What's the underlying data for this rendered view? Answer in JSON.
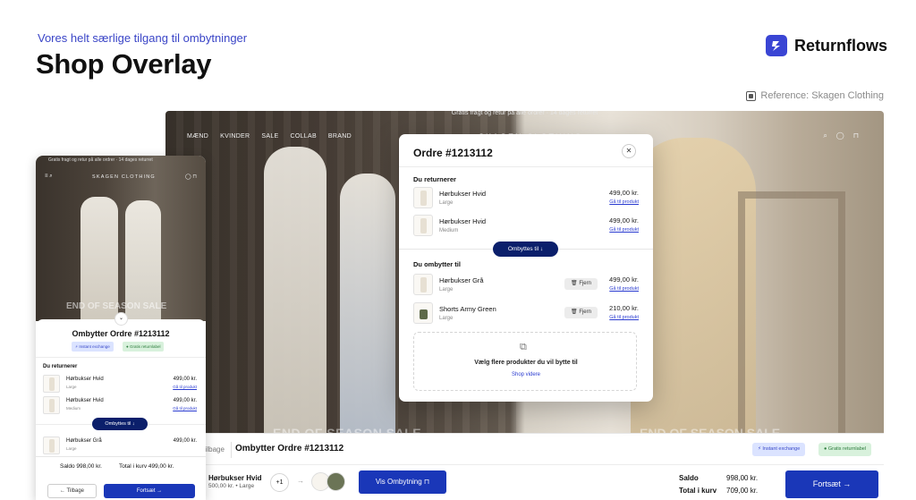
{
  "header": {
    "subtitle": "Vores helt særlige tilgang til ombytninger",
    "title": "Shop Overlay",
    "brand": "Returnflows",
    "reference": "Reference: Skagen Clothing"
  },
  "store": {
    "promo": "Gratis fragt og retur på alle ordrer · 14 dages returret",
    "nav": [
      "MÆND",
      "KVINDER",
      "SALE",
      "COLLAB",
      "BRAND"
    ],
    "logo": "SKAGEN CLOTHING",
    "hero_text": "END OF SEASON SALE"
  },
  "modal": {
    "title": "Ordre #1213112",
    "returning_label": "Du returnerer",
    "returning": [
      {
        "name": "Hørbukser Hvid",
        "size": "Large",
        "price": "499,00 kr.",
        "link": "Gå til produkt"
      },
      {
        "name": "Hørbukser Hvid",
        "size": "Medium",
        "price": "499,00 kr.",
        "link": "Gå til produkt"
      }
    ],
    "swap_button": "Ombyttes til ↓",
    "exchange_label": "Du ombytter til",
    "exchanging": [
      {
        "name": "Hørbukser Grå",
        "size": "Large",
        "price": "499,00 kr.",
        "link": "Gå til produkt",
        "remove": "Fjern"
      },
      {
        "name": "Shorts Army Green",
        "size": "Large",
        "price": "210,00 kr.",
        "link": "Gå til produkt",
        "remove": "Fjern"
      }
    ],
    "add_title": "Vælg flere produkter du vil bytte til",
    "add_link": "Shop videre"
  },
  "desktop_bar": {
    "back": "Tilbage",
    "order_title": "Ombytter Ordre #1213112",
    "badge_exchange": "Instant exchange",
    "badge_return": "Gratis returnlabel",
    "product_name": "Hørbukser Hvid",
    "product_sub": "500,00 kr. • Large",
    "plus": "+1",
    "view_button": "Vis Ombytning",
    "saldo_label": "Saldo",
    "saldo_value": "998,00 kr.",
    "total_label": "Total i kurv",
    "total_value": "709,00 kr.",
    "continue_button": "Fortsæt →"
  },
  "mobile": {
    "title": "Ombytter Ordre #1213112",
    "badge_exchange": "Instant exchange",
    "badge_return": "Gratis returnlabel",
    "returning_label": "Du returnerer",
    "returning": [
      {
        "name": "Hørbukser Hvid",
        "size": "Large",
        "price": "499,00 kr.",
        "link": "Gå til produkt"
      },
      {
        "name": "Hørbukser Hvid",
        "size": "Medium",
        "price": "499,00 kr.",
        "link": "Gå til produkt"
      }
    ],
    "swap_button": "Ombyttes til ↓",
    "exchanging": [
      {
        "name": "Hørbukser Grå",
        "size": "Large",
        "price": "499,00 kr."
      }
    ],
    "saldo": "Saldo   998,00 kr.",
    "total": "Total i kurv   499,00 kr.",
    "back_button": "← Tilbage",
    "continue_button": "Fortsæt →"
  },
  "colors": {
    "accent": "#1a37b8",
    "navy": "#0b1f6b",
    "link": "#2a3bd0"
  }
}
